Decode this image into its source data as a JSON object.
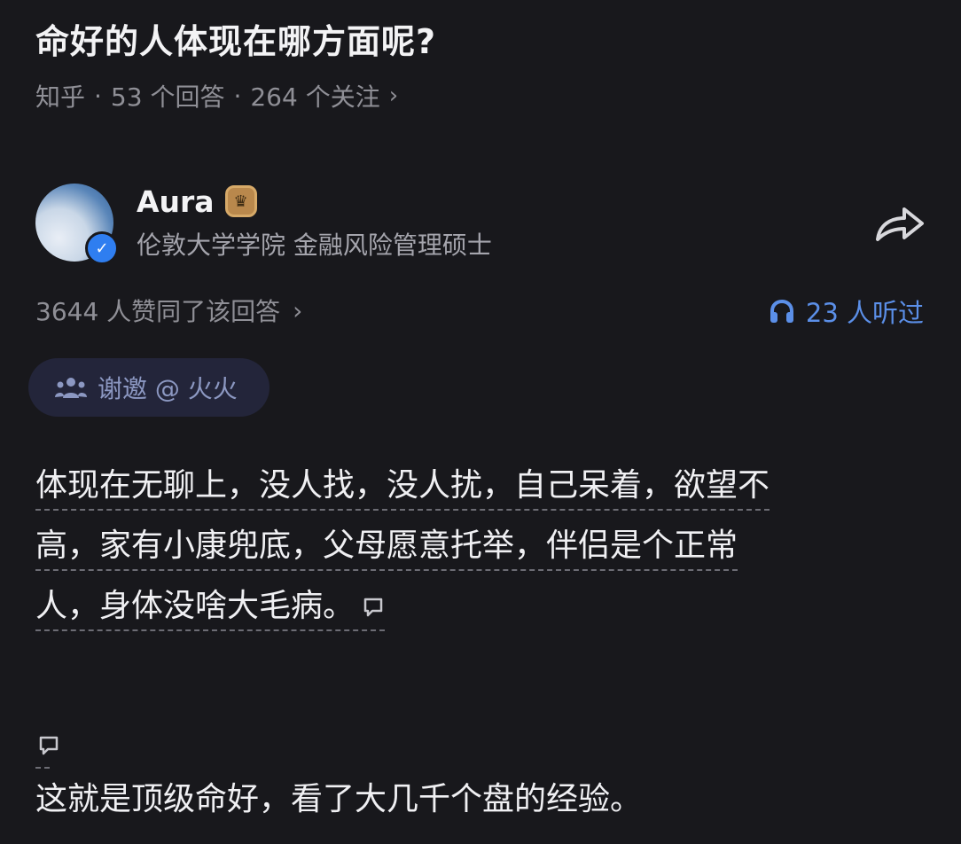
{
  "question": {
    "title": "命好的人体现在哪方面呢?",
    "source": "知乎",
    "sep": "·",
    "answers": "53 个回答",
    "followers": "264 个关注",
    "chevron": "›"
  },
  "author": {
    "name": "Aura",
    "description": "伦敦大学学院 金融风险管理硕士",
    "verified_icon": "verified-check-icon",
    "badge_icon": "crown-icon"
  },
  "stats": {
    "likes": "3644 人赞同了该回答",
    "chevron": "›",
    "listened": "23 人听过",
    "listen_icon": "headphones-icon",
    "accent": "#5b8fe8"
  },
  "invite": {
    "label": "谢邀 @ 火火",
    "icon": "group-people-icon"
  },
  "answer": {
    "lines": [
      "体现在无聊上，没人找，没人扰，自己呆着，欲望不",
      "高，家有小康兜底，父母愿意托举，伴侣是个正常",
      "人，身体没啥大毛病。"
    ],
    "second_paragraph": "这就是顶级命好，看了大几千个盘的经验。"
  },
  "colors": {
    "background": "#18181c",
    "text": "#f0f0f3",
    "muted": "#8f8f96",
    "invite_bg": "#23253a",
    "gold": "#b9884c"
  }
}
